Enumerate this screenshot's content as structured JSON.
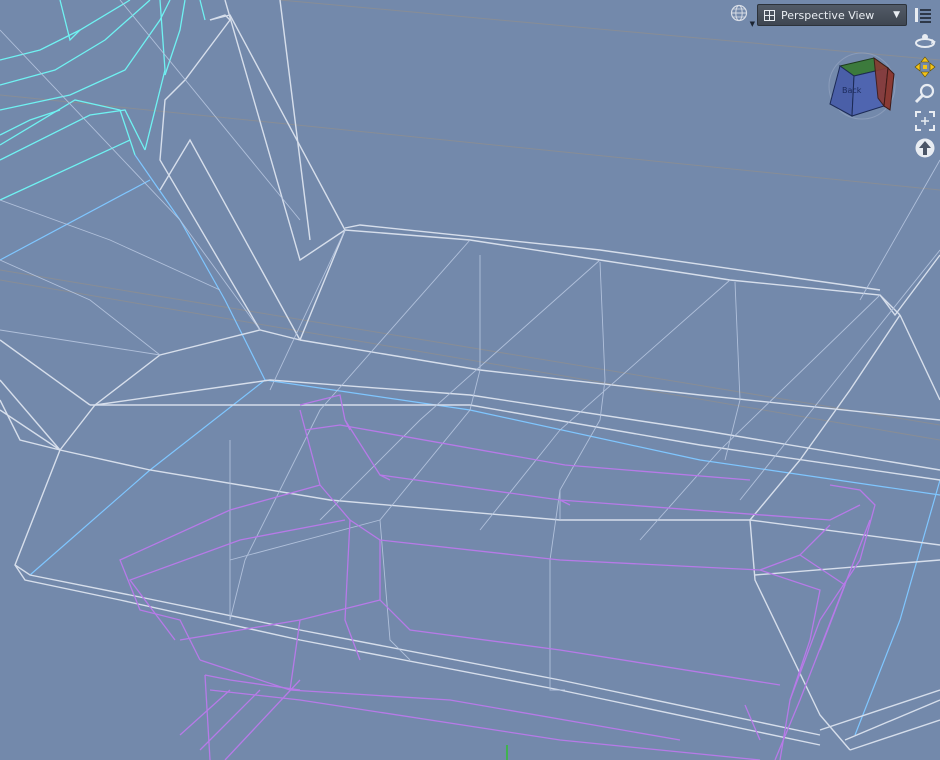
{
  "viewport": {
    "view_name": "Perspective View",
    "background": "#7389ab",
    "colors": {
      "grid": "#8e8e8e",
      "selected_mesh": "#c9d3e6",
      "mesh_inner": "#b1c1df",
      "purple_mesh": "#b77ae8",
      "cyan_mesh": "#6ff2f2",
      "blue_edge": "#7fc6ff"
    }
  },
  "toolbar": {
    "display_icon": "globe-icon",
    "menu_icon": "menu-lines-icon"
  },
  "view_cube": {
    "face_label": "Back",
    "top_color": "#3c7a3c",
    "front_color": "#4a5fa8",
    "side_color": "#8a3a34"
  },
  "nav_tools": [
    {
      "name": "orbit-icon"
    },
    {
      "name": "pan-icon"
    },
    {
      "name": "zoom-icon"
    },
    {
      "name": "frame-icon"
    },
    {
      "name": "reset-icon"
    }
  ]
}
